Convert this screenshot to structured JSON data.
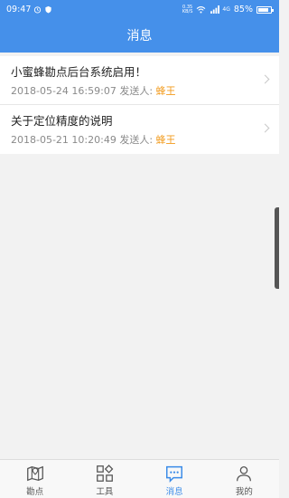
{
  "status_bar": {
    "time": "09:47",
    "speed_value": "0.35",
    "speed_unit": "KB/S",
    "network": "4G",
    "battery_text": "85%",
    "battery_level": 0.85
  },
  "header": {
    "title": "消息"
  },
  "messages": [
    {
      "title": "小蜜蜂勘点后台系统启用！",
      "date": "2018-05-24 16:59:07",
      "sender_label": "发送人:",
      "sender": "蜂王"
    },
    {
      "title": "关于定位精度的说明",
      "date": "2018-05-21 10:20:49",
      "sender_label": "发送人:",
      "sender": "蜂王"
    }
  ],
  "tabs": [
    {
      "label": "勘点",
      "icon": "map-icon",
      "active": false
    },
    {
      "label": "工具",
      "icon": "grid-icon",
      "active": false
    },
    {
      "label": "消息",
      "icon": "chat-icon",
      "active": true
    },
    {
      "label": "我的",
      "icon": "user-icon",
      "active": false
    }
  ],
  "colors": {
    "primary": "#4590ea",
    "sender": "#f29b1d",
    "active_tab": "#3a8be8"
  }
}
